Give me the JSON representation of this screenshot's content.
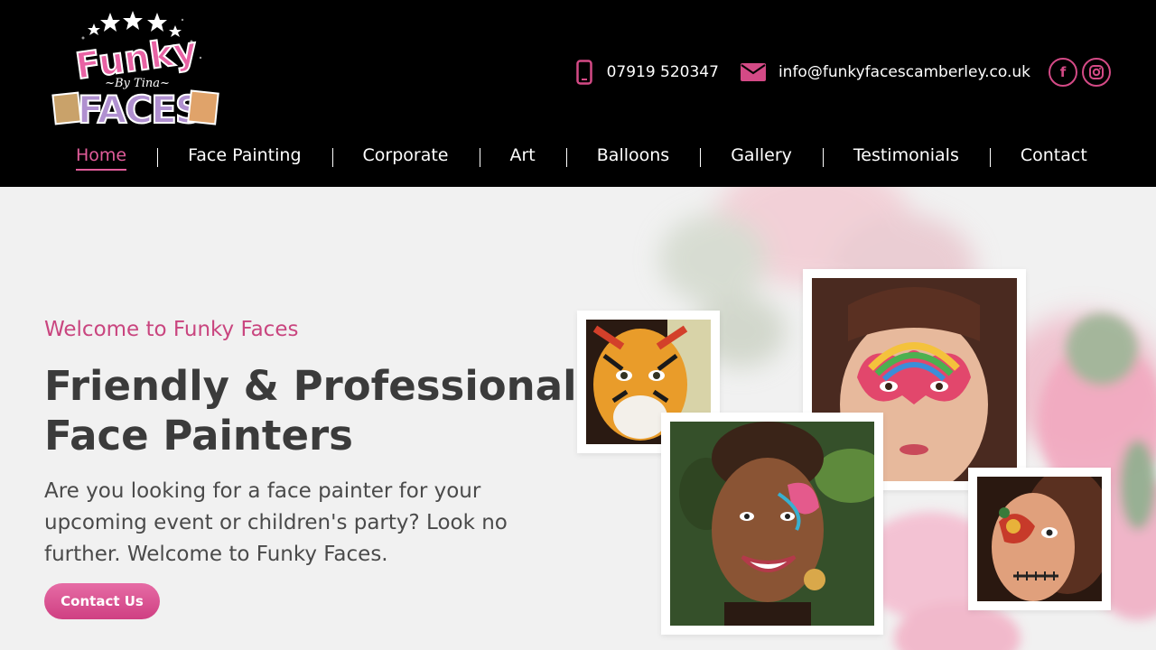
{
  "logo": {
    "line1": "Funky",
    "line2": "~By Tina~",
    "line3": "FACES"
  },
  "contact": {
    "phone": "07919 520347",
    "email": "info@funkyfacescamberley.co.uk",
    "phone_icon": "phone-icon",
    "email_icon": "envelope-icon"
  },
  "social": {
    "facebook": "f",
    "instagram_icon": "instagram-icon"
  },
  "nav": {
    "items": [
      {
        "label": "Home"
      },
      {
        "label": "Face Painting"
      },
      {
        "label": "Corporate"
      },
      {
        "label": "Art"
      },
      {
        "label": "Balloons"
      },
      {
        "label": "Gallery"
      },
      {
        "label": "Testimonials"
      },
      {
        "label": "Contact"
      }
    ],
    "active": "Home"
  },
  "hero": {
    "eyebrow": "Welcome to Funky Faces",
    "headline_line1": "Friendly & Professional",
    "headline_line2": "Face Painters",
    "intro": "Are you looking for a face painter for your upcoming event or children's party? Look no further. Welcome to Funky Faces.",
    "cta_label": "Contact Us"
  },
  "colors": {
    "accent": "#d44a86",
    "header_bg": "#000000",
    "hero_bg": "#f1f1f1",
    "heading": "#3b3b3b"
  }
}
